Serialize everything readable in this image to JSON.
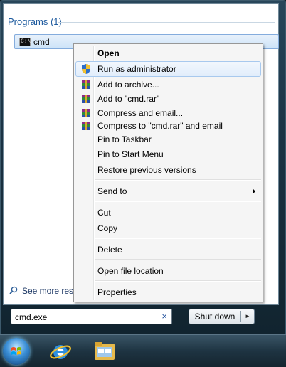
{
  "search_results": {
    "programs_header": "Programs (1)",
    "items": [
      {
        "label": "cmd",
        "icon": "cmd-icon"
      }
    ],
    "see_more_label": "See more results"
  },
  "search": {
    "value": "cmd.exe",
    "clear_label": "×"
  },
  "shutdown": {
    "label": "Shut down",
    "arrow": "►"
  },
  "taskbar": {
    "items": [
      "start-orb",
      "internet-explorer-icon",
      "windows-explorer-icon"
    ]
  },
  "context_menu": {
    "items": [
      {
        "label": "Open",
        "bold": true
      },
      {
        "label": "Run as administrator",
        "icon": "uac-shield-icon",
        "highlighted": true
      },
      {
        "label": "Add to archive...",
        "icon": "winrar-icon"
      },
      {
        "label": "Add to \"cmd.rar\"",
        "icon": "winrar-icon"
      },
      {
        "label": "Compress and email...",
        "icon": "winrar-icon"
      },
      {
        "label": "Compress to \"cmd.rar\" and email",
        "icon": "winrar-icon"
      },
      {
        "label": "Pin to Taskbar"
      },
      {
        "label": "Pin to Start Menu"
      },
      {
        "label": "Restore previous versions"
      },
      {
        "label": "Send to",
        "submenu": true
      },
      {
        "label": "Cut"
      },
      {
        "label": "Copy"
      },
      {
        "label": "Delete"
      },
      {
        "label": "Open file location"
      },
      {
        "label": "Properties"
      }
    ]
  },
  "colors": {
    "accent": "#1d5a9e",
    "highlight_border": "#a8c9ee",
    "taskbar": "#1e3442"
  }
}
